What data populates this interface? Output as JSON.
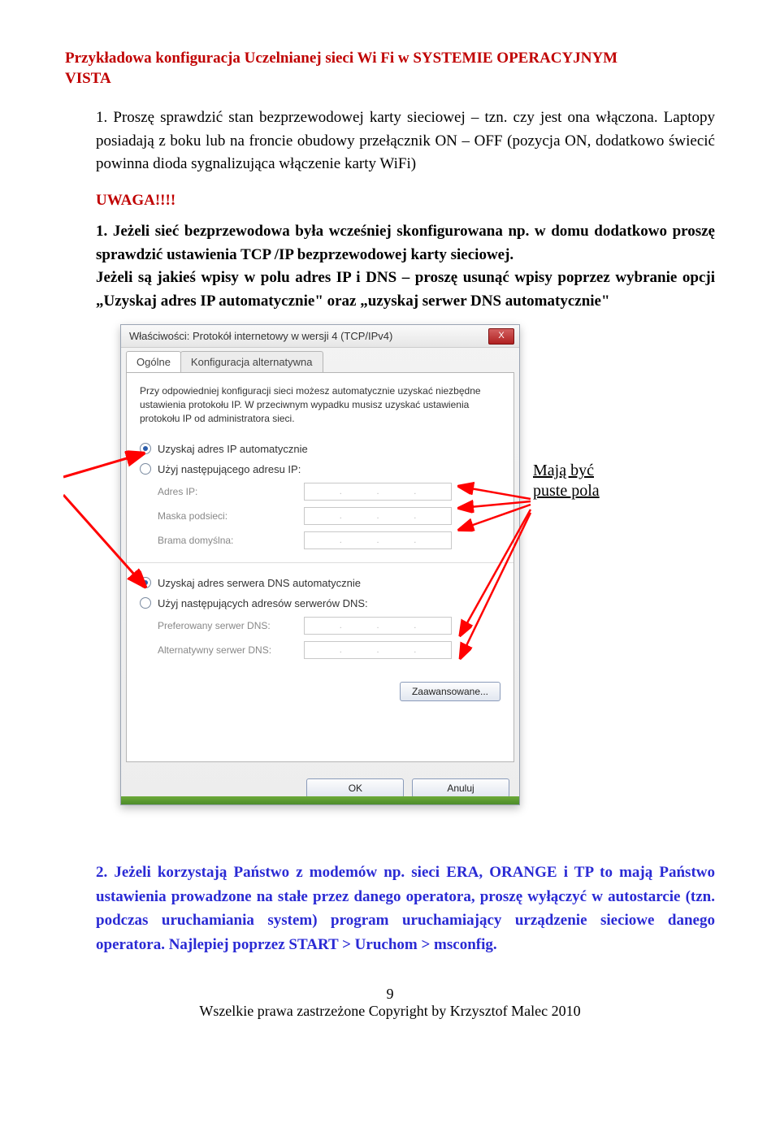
{
  "header": {
    "line1": "Przykładowa konfiguracja Uczelnianej sieci Wi Fi  w SYSTEMIE OPERACYJNYM",
    "line2": "VISTA"
  },
  "item1": {
    "num": "1.",
    "text": "Proszę sprawdzić stan bezprzewodowej karty sieciowej – tzn. czy jest ona włączona. Laptopy posiadają z boku lub na froncie obudowy przełącznik ON – OFF (pozycja ON, dodatkowo świecić powinna dioda sygnalizująca włączenie karty WiFi)"
  },
  "uwaga": "UWAGA!!!!",
  "sub1": {
    "prefix": "1. Jeżeli sieć bezprzewodowa była wcześniej skonfigurowana np. w domu dodatkowo proszę sprawdzić ustawienia TCP /IP bezprzewodowej karty sieciowej."
  },
  "sub2": "Jeżeli są jakieś wpisy w polu adres IP i DNS – proszę usunąć wpisy poprzez wybranie opcji „Uzyskaj adres IP automatycznie\" oraz „uzyskaj serwer DNS automatycznie\"",
  "dialog": {
    "title": "Właściwości: Protokół internetowy w wersji 4 (TCP/IPv4)",
    "close": "X",
    "tab_general": "Ogólne",
    "tab_alt": "Konfiguracja alternatywna",
    "description": "Przy odpowiedniej konfiguracji sieci możesz automatycznie uzyskać niezbędne ustawienia protokołu IP. W przeciwnym wypadku musisz uzyskać ustawienia protokołu IP od administratora sieci.",
    "radio_ip_auto": "Uzyskaj adres IP automatycznie",
    "radio_ip_manual": "Użyj następującego adresu IP:",
    "label_ip": "Adres IP:",
    "label_mask": "Maska podsieci:",
    "label_gateway": "Brama domyślna:",
    "radio_dns_auto": "Uzyskaj adres serwera DNS automatycznie",
    "radio_dns_manual": "Użyj następujących adresów serwerów DNS:",
    "label_pref_dns": "Preferowany serwer DNS:",
    "label_alt_dns": "Alternatywny serwer DNS:",
    "btn_advanced": "Zaawansowane...",
    "btn_ok": "OK",
    "btn_cancel": "Anuluj"
  },
  "annotation": {
    "line1": "Mają być",
    "line2": "puste pola"
  },
  "item2": "2. Jeżeli korzystają Państwo z modemów np. sieci ERA, ORANGE i  TP to mają Państwo ustawienia prowadzone  na stałe przez danego operatora, proszę wyłączyć w autostarcie (tzn. podczas uruchamiania system) program uruchamiający urządzenie sieciowe danego operatora. Najlepiej poprzez START > Uruchom > msconfig.",
  "page_num": "9",
  "copyright": "Wszelkie prawa zastrzeżone Copyright by Krzysztof Malec  2010"
}
